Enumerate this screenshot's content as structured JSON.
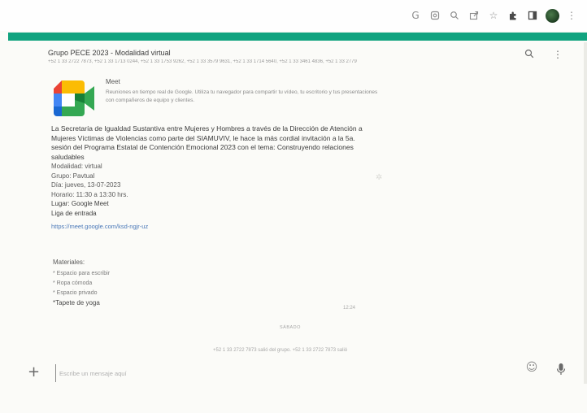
{
  "browser": {
    "toolbar_icons": [
      "google-icon",
      "lens-icon",
      "zoom-icon",
      "share-icon",
      "bookmark-star-icon",
      "extensions-icon",
      "sidebar-icon",
      "profile-avatar",
      "more-vert-icon"
    ]
  },
  "colors": {
    "accent": "#11a37f",
    "link": "#4a78b8",
    "meet_yellow": "#fbbc04",
    "meet_green": "#34a853",
    "meet_blue": "#4285f4",
    "meet_red": "#ea4335"
  },
  "header": {
    "title": "Grupo PECE 2023 - Modalidad virtual",
    "participants": "+52 1 33 2722 7873, +52 1 33 1713 0244, +52 1 33 1753 9262, +52 1 33 3579 9631, +52 1 33 1714 5640, +52 1 33 3461 4836, +52 1 33 2779"
  },
  "meet_preview": {
    "title": "Meet",
    "description": "Reuniones en tiempo real de Google. Utiliza tu navegador para compartir tu vídeo, tu escritorio y tus presentaciones con compañeros de equipo y clientes."
  },
  "message": {
    "intro": "La Secretaría de Igualdad Sustantiva entre Mujeres y Hombres a través de la Dirección de Atención a Mujeres Víctimas de Violencias como parte del SIAMUVIV, le hace la más cordial invitación a la 5a. sesión del Programa Estatal de Contención Emocional 2023 con el tema: Construyendo relaciones saludables",
    "lines": [
      "Modalidad: virtual",
      "Grupo: Pavtual",
      "Día: jueves, 13-07-2023",
      "Horario: 11:30 a 13:30 hrs.",
      "Lugar: Google Meet",
      "Liga de entrada"
    ],
    "link": "https://meet.google.com/ksd-ngjr-uz",
    "materials_title": "Materiales:",
    "materials": [
      "* Espacio para escribir",
      "* Ropa cómoda",
      "* Espacio privado",
      "*Tapete de yoga"
    ],
    "time": "12:24"
  },
  "divider": {
    "label": "SÁBADO"
  },
  "system_message": "+52 1 33 2722 7873 salió del grupo. +52 1 33 2722 7873 salió",
  "composer": {
    "placeholder": "Escribe un mensaje aquí"
  }
}
